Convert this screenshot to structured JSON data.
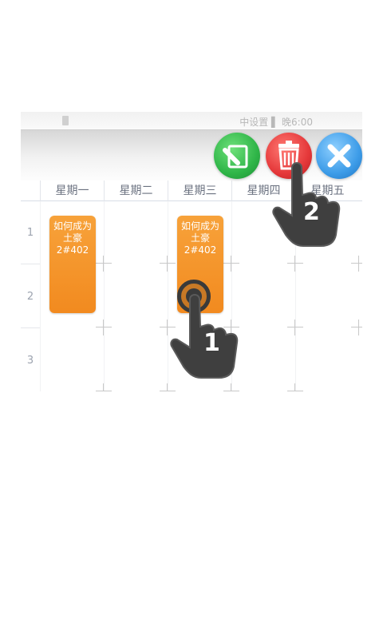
{
  "status_bar": {
    "text": "中设置 ▌ 晚6:00"
  },
  "toolbar": {
    "edit_icon": "edit-icon",
    "delete_icon": "trash-icon",
    "close_icon": "close-icon"
  },
  "days": [
    "星期一",
    "星期二",
    "星期三",
    "星期四",
    "星期五"
  ],
  "rows": [
    "1",
    "2",
    "3"
  ],
  "courses": [
    {
      "line1": "如何成为",
      "line2": "土豪",
      "line3": "2#402"
    },
    {
      "line1": "如何成为",
      "line2": "土豪",
      "line3": "2#402"
    }
  ],
  "gestures": [
    "1",
    "2"
  ]
}
